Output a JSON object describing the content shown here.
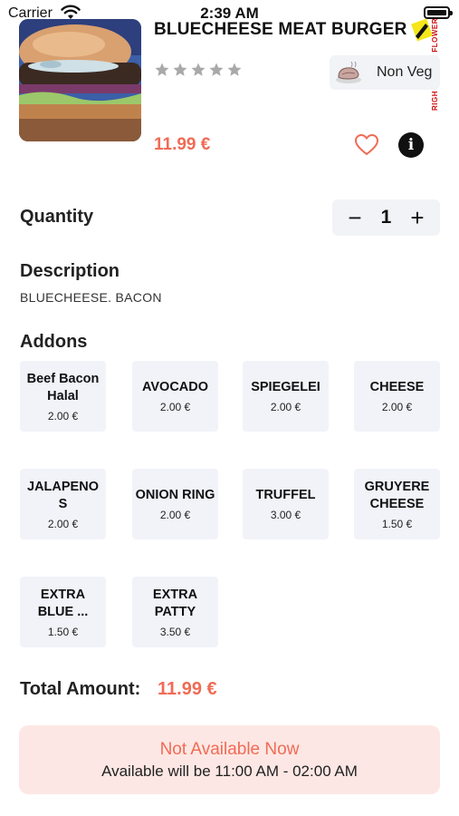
{
  "status_bar": {
    "carrier": "Carrier",
    "time": "2:39 AM"
  },
  "product": {
    "title": "BLUECHEESE MEAT BURGER",
    "rating_stars": 0,
    "rating_max": 5,
    "diet_label": "Non Veg",
    "price": "11.99 €",
    "side_tags": [
      "FLOWER",
      "RIGH"
    ]
  },
  "quantity": {
    "label": "Quantity",
    "minus": "−",
    "value": "1",
    "plus": "+"
  },
  "description": {
    "label": "Description",
    "text": "BLUECHEESE. BACON"
  },
  "addons": {
    "label": "Addons",
    "items": [
      {
        "name": "Beef Bacon Halal",
        "price": "2.00 €"
      },
      {
        "name": "AVOCADO",
        "price": "2.00 €"
      },
      {
        "name": "SPIEGELEI",
        "price": "2.00 €"
      },
      {
        "name": "CHEESE",
        "price": "2.00 €"
      },
      {
        "name": "JALAPENOS",
        "price": "2.00 €"
      },
      {
        "name": "ONION RING",
        "price": "2.00 €"
      },
      {
        "name": "TRUFFEL",
        "price": "3.00 €"
      },
      {
        "name": "GRUYERE CHEESE",
        "price": "1.50 €"
      },
      {
        "name": "EXTRA BLUE ...",
        "price": "1.50 €"
      },
      {
        "name": "EXTRA PATTY",
        "price": "3.50 €"
      }
    ]
  },
  "total": {
    "label": "Total Amount:",
    "value": "11.99 €"
  },
  "availability": {
    "title": "Not Available Now",
    "subtitle": "Available will be 11:00 AM - 02:00 AM"
  },
  "colors": {
    "accent": "#f06b55",
    "chip_bg": "#f1f3f8",
    "banner_bg": "#fde7e4",
    "star_empty": "#a9a9a9"
  },
  "icons": {
    "wifi": "wifi-icon",
    "battery": "battery-icon",
    "star": "star-icon",
    "diet": "meat-icon",
    "favorite": "heart-icon",
    "info": "info-icon",
    "edit": "pencil-icon"
  }
}
